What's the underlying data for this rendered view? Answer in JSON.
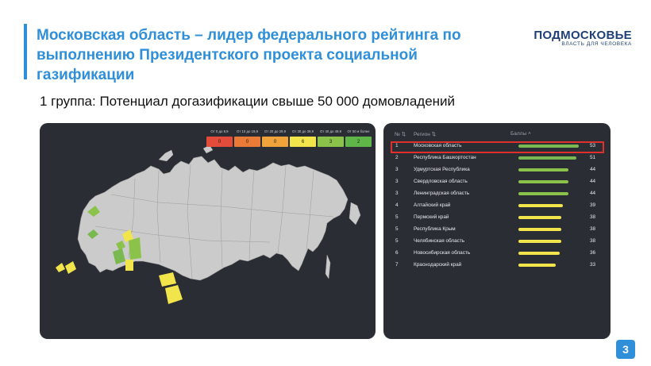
{
  "header": {
    "title": "Московская область – лидер федерального рейтинга по выполнению Президентского проекта социальной газификации",
    "logo_main": "ПОДМОСКОВЬЕ",
    "logo_tagline": "ВЛАСТЬ ДЛЯ ЧЕЛОВЕКА"
  },
  "subtitle": "1 группа: Потенциал догазификации свыше 50 000 домовладений",
  "legend": {
    "labels": [
      "От 0 до 9,9",
      "От 10 до 19,9",
      "От 20 до 29,9",
      "От 30 до 39,9",
      "От 40 до 49,9",
      "От 50 и более"
    ],
    "counts": [
      "0",
      "0",
      "0",
      "6",
      "3",
      "2"
    ],
    "colors": [
      "#e34b3b",
      "#ea7b36",
      "#f0a33b",
      "#f2e54b",
      "#8bc34a",
      "#5fb548"
    ]
  },
  "table": {
    "headers": {
      "rank": "№ ⇅",
      "region": "Регион ⇅",
      "score": "Баллы ˄"
    },
    "max_score": 60,
    "rows": [
      {
        "rank": "1",
        "region": "Московская область",
        "score": "53",
        "color": "#79b94f",
        "highlight": true
      },
      {
        "rank": "2",
        "region": "Республика Башкортостан",
        "score": "51",
        "color": "#79b94f"
      },
      {
        "rank": "3",
        "region": "Удмуртская Республика",
        "score": "44",
        "color": "#8bc34a"
      },
      {
        "rank": "3",
        "region": "Свердловская область",
        "score": "44",
        "color": "#8bc34a"
      },
      {
        "rank": "3",
        "region": "Ленинградская область",
        "score": "44",
        "color": "#8bc34a"
      },
      {
        "rank": "4",
        "region": "Алтайский край",
        "score": "39",
        "color": "#f2e54b"
      },
      {
        "rank": "5",
        "region": "Пермский край",
        "score": "38",
        "color": "#f2e54b"
      },
      {
        "rank": "5",
        "region": "Республика Крым",
        "score": "38",
        "color": "#f2e54b"
      },
      {
        "rank": "5",
        "region": "Челябинская область",
        "score": "38",
        "color": "#f2e54b"
      },
      {
        "rank": "6",
        "region": "Новосибирская область",
        "score": "36",
        "color": "#f2e54b"
      },
      {
        "rank": "7",
        "region": "Краснодарский край",
        "score": "33",
        "color": "#f2e54b"
      }
    ]
  },
  "page_number": "3"
}
